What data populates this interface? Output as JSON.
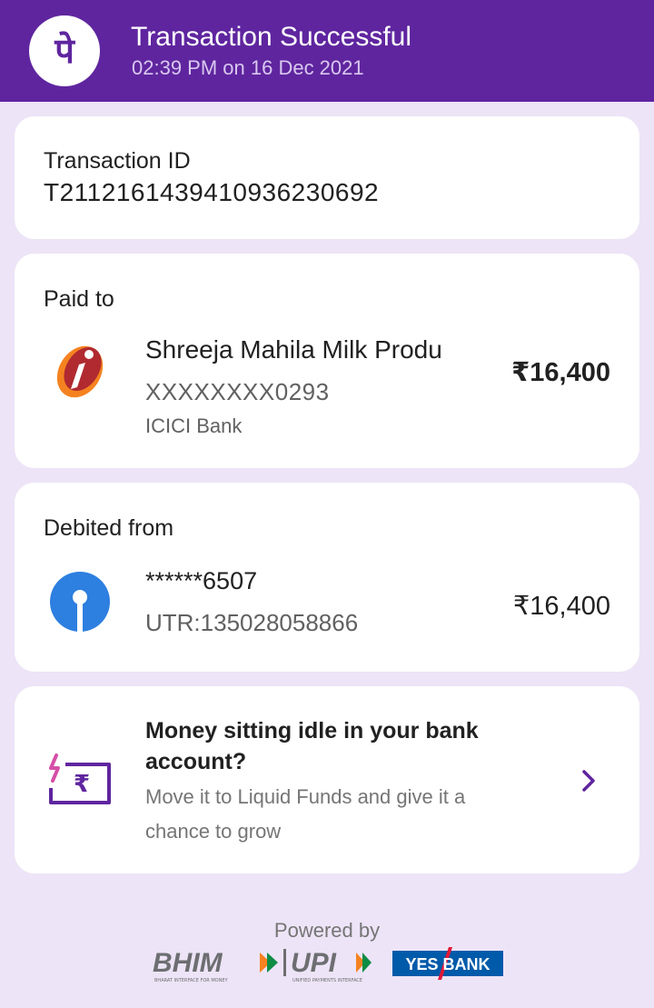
{
  "header": {
    "title": "Transaction Successful",
    "subtitle": "02:39 PM on 16 Dec 2021",
    "logo_icon": "phonepe-logo-icon",
    "logo_glyph": "पे",
    "background": "#5f259f"
  },
  "transaction": {
    "label": "Transaction ID",
    "id": "T2112161439410936230692"
  },
  "paid_to": {
    "label": "Paid to",
    "name": "Shreeja Mahila Milk Produ",
    "account": "XXXXXXXX0293",
    "bank": "ICICI Bank",
    "amount": "₹16,400",
    "icon": "icici-bank-icon"
  },
  "debited_from": {
    "label": "Debited from",
    "account": "******6507",
    "utr": "UTR:135028058866",
    "amount": "₹16,400",
    "icon": "sbi-bank-icon"
  },
  "promo": {
    "title": "Money sitting idle in your bank account?",
    "text": "Move it to Liquid Funds and give it a chance to grow",
    "icon": "rupee-card-icon",
    "arrow_icon": "chevron-right-icon"
  },
  "footer": {
    "powered_by": "Powered by",
    "bhim": "BHIM",
    "bhim_tagline": "BHARAT INTERFACE FOR MONEY",
    "upi": "UPI",
    "upi_tagline": "UNIFIED PAYMENTS INTERFACE",
    "yes_bank": "YES BANK"
  },
  "colors": {
    "brand_purple": "#5f259f",
    "page_background": "#ede4f7",
    "icici_orange": "#f58220",
    "icici_red": "#b02a30",
    "sbi_blue": "#2d7fe0",
    "yes_bank_blue": "#005aaa"
  }
}
